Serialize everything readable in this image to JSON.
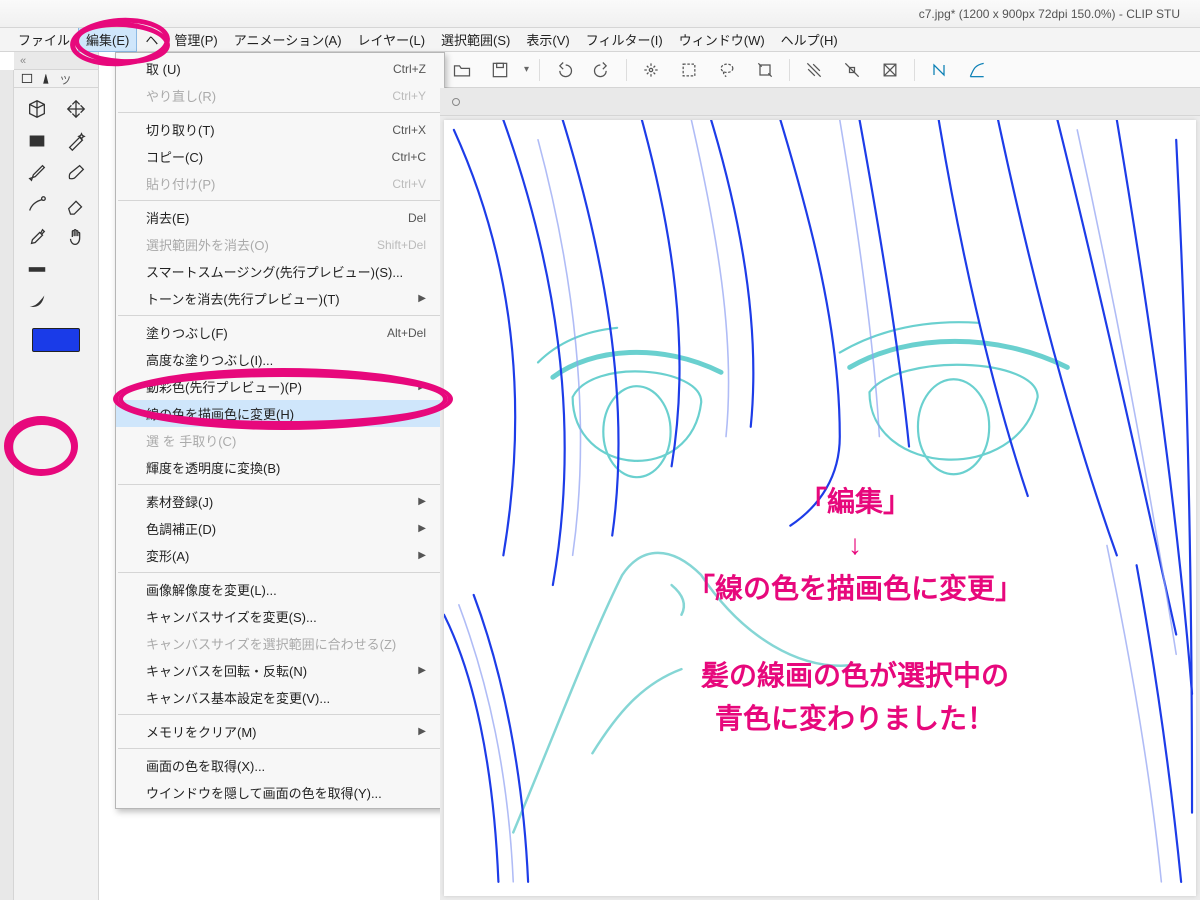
{
  "title": "c7.jpg* (1200 x 900px 72dpi 150.0%)  - CLIP STU",
  "menubar": {
    "file": "ファイル",
    "edit": "編集(E)",
    "tail": "ヘ",
    "kanri": "管理(P)",
    "anim": "アニメーション(A)",
    "layer": "レイヤー(L)",
    "select": "選択範囲(S)",
    "view": "表示(V)",
    "filter": "フィルター(I)",
    "window": "ウィンドウ(W)",
    "help": "ヘルプ(H)"
  },
  "dropdown": {
    "undo": {
      "label": "取        (U)",
      "shortcut": "Ctrl+Z"
    },
    "redo": {
      "label": "やり直し(R)",
      "shortcut": "Ctrl+Y"
    },
    "cut": {
      "label": "切り取り(T)",
      "shortcut": "Ctrl+X"
    },
    "copy": {
      "label": "コピー(C)",
      "shortcut": "Ctrl+C"
    },
    "paste": {
      "label": "貼り付け(P)",
      "shortcut": "Ctrl+V"
    },
    "erase": {
      "label": "消去(E)",
      "shortcut": "Del"
    },
    "eraseOut": {
      "label": "選択範囲外を消去(O)",
      "shortcut": "Shift+Del"
    },
    "smart": {
      "label": "スマートスムージング(先行プレビュー)(S)...",
      "shortcut": ""
    },
    "toneErase": {
      "label": "トーンを消去(先行プレビュー)(T)",
      "shortcut": ""
    },
    "fill": {
      "label": "塗りつぶし(F)",
      "shortcut": "Alt+Del"
    },
    "advFill": {
      "label": "高度な塗りつぶし(I)...",
      "shortcut": ""
    },
    "autoColor": {
      "label": "    動彩色(先行プレビュー)(P)",
      "shortcut": ""
    },
    "lineColor": {
      "label": "線の色を描画色に変更(H)",
      "shortcut": ""
    },
    "selTrim": {
      "label": "選                を    手取り(C)",
      "shortcut": ""
    },
    "brightAlpha": {
      "label": "輝度を透明度に変換(B)",
      "shortcut": ""
    },
    "material": {
      "label": "素材登録(J)",
      "shortcut": ""
    },
    "colorAdj": {
      "label": "色調補正(D)",
      "shortcut": ""
    },
    "transform": {
      "label": "変形(A)",
      "shortcut": ""
    },
    "imgRes": {
      "label": "画像解像度を変更(L)...",
      "shortcut": ""
    },
    "canvSize": {
      "label": "キャンバスサイズを変更(S)...",
      "shortcut": ""
    },
    "canvSel": {
      "label": "キャンバスサイズを選択範囲に合わせる(Z)",
      "shortcut": ""
    },
    "canvRot": {
      "label": "キャンバスを回転・反転(N)",
      "shortcut": ""
    },
    "canvBase": {
      "label": "キャンバス基本設定を変更(V)...",
      "shortcut": ""
    },
    "memClear": {
      "label": "メモリをクリア(M)",
      "shortcut": ""
    },
    "pickColor": {
      "label": "画面の色を取得(X)...",
      "shortcut": ""
    },
    "hidePick": {
      "label": "ウインドウを隠して画面の色を取得(Y)...",
      "shortcut": ""
    }
  },
  "sidebarLabel": "ツ",
  "collapseGlyph": "«",
  "annotation": "「編集」\n↓\n「線の色を描画色に変更」\n\n髪の線画の色が選択中の\n青色に変わりました！",
  "swatchColor": "#1a3be8"
}
